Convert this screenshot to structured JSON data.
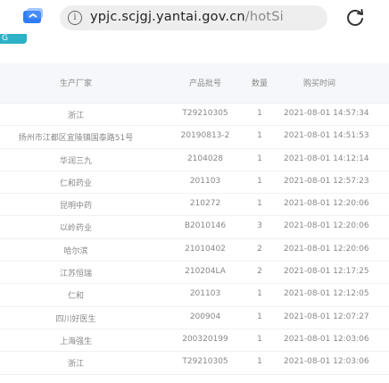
{
  "browser": {
    "url_main": "ypjc.scjgj.yantai.gov.cn",
    "url_path": "/hotSi",
    "info_glyph": "i"
  },
  "page": {
    "tag_label": "G"
  },
  "table": {
    "headers": [
      "生产厂家",
      "产品批号",
      "数量",
      "购买时间"
    ],
    "rows": [
      [
        "浙江",
        "T29210305",
        "1",
        "2021-08-01 14:57:34"
      ],
      [
        "扬州市江都区宜陵镇国泰路51号",
        "20190813-2",
        "1",
        "2021-08-01 14:51:53"
      ],
      [
        "华润三九",
        "2104028",
        "1",
        "2021-08-01 14:12:14"
      ],
      [
        "仁和药业",
        "201103",
        "1",
        "2021-08-01 12:57:23"
      ],
      [
        "昆明中药",
        "210272",
        "1",
        "2021-08-01 12:20:06"
      ],
      [
        "以岭药业",
        "B2010146",
        "3",
        "2021-08-01 12:20:06"
      ],
      [
        "哈尔滨",
        "21010402",
        "2",
        "2021-08-01 12:20:06"
      ],
      [
        "江苏恒瑞",
        "210204LA",
        "2",
        "2021-08-01 12:17:25"
      ],
      [
        "仁和",
        "201103",
        "1",
        "2021-08-01 12:12:05"
      ],
      [
        "四川好医生",
        "200904",
        "1",
        "2021-08-01 12:07:27"
      ],
      [
        "上海强生",
        "200320199",
        "1",
        "2021-08-01 12:03:06"
      ],
      [
        "浙江",
        "T29210305",
        "1",
        "2021-08-01 12:03:06"
      ]
    ]
  },
  "colors": {
    "accent": "#2db1c6",
    "browser_tab_icon": "#2f7cf6"
  }
}
